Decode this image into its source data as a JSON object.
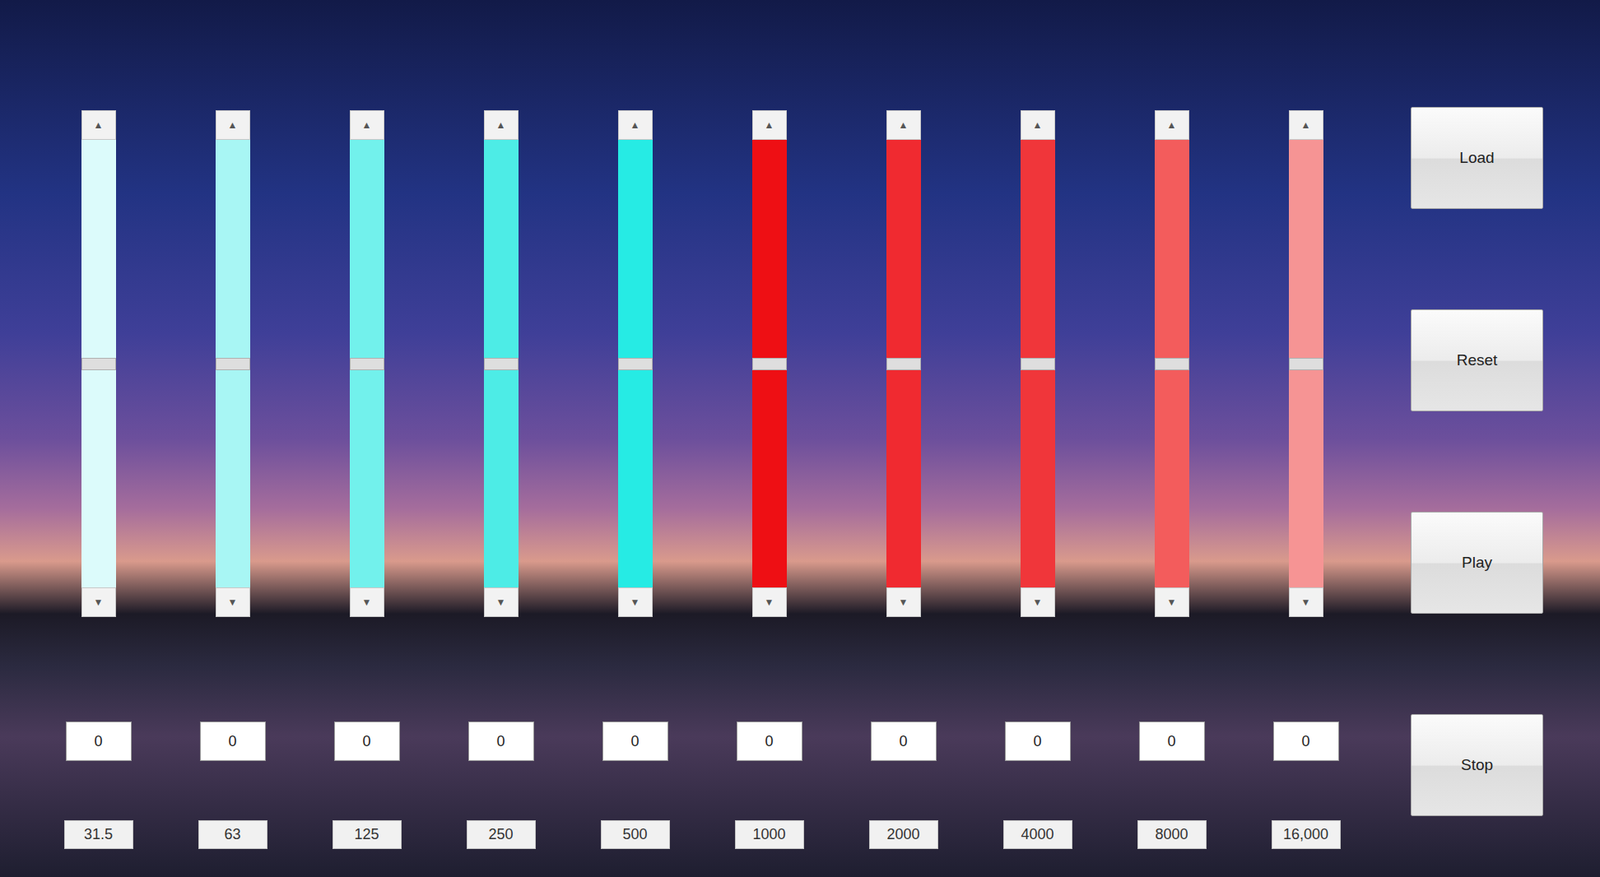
{
  "equalizer": {
    "bands": [
      {
        "frequency": "31.5",
        "value": "0",
        "level": 0.5,
        "color": "#dcfbfb"
      },
      {
        "frequency": "63",
        "value": "0",
        "level": 0.5,
        "color": "#a8f6f4"
      },
      {
        "frequency": "125",
        "value": "0",
        "level": 0.5,
        "color": "#72f1ec"
      },
      {
        "frequency": "250",
        "value": "0",
        "level": 0.5,
        "color": "#4decE6"
      },
      {
        "frequency": "500",
        "value": "0",
        "level": 0.5,
        "color": "#26ebe4"
      },
      {
        "frequency": "1000",
        "value": "0",
        "level": 0.5,
        "color": "#ee0f14"
      },
      {
        "frequency": "2000",
        "value": "0",
        "level": 0.5,
        "color": "#f02a30"
      },
      {
        "frequency": "4000",
        "value": "0",
        "level": 0.5,
        "color": "#f0363a"
      },
      {
        "frequency": "8000",
        "value": "0",
        "level": 0.5,
        "color": "#f35c5c"
      },
      {
        "frequency": "16,000",
        "value": "0",
        "level": 0.5,
        "color": "#f69494"
      }
    ]
  },
  "scroll_arrows": {
    "up": "▲",
    "down": "▼"
  },
  "buttons": [
    "Load",
    "Reset",
    "Play",
    "Stop"
  ]
}
